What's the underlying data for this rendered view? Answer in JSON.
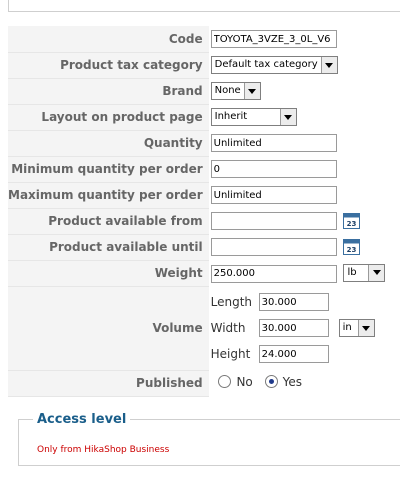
{
  "fields": {
    "code": {
      "label": "Code",
      "value": "TOYOTA_3VZE_3_0L_V6"
    },
    "tax_category": {
      "label": "Product tax category",
      "selected": "Default tax category"
    },
    "brand": {
      "label": "Brand",
      "selected": "None"
    },
    "layout": {
      "label": "Layout on product page",
      "selected": "Inherit"
    },
    "quantity": {
      "label": "Quantity",
      "value": "Unlimited"
    },
    "min_qty": {
      "label": "Minimum quantity per order",
      "value": "0"
    },
    "max_qty": {
      "label": "Maximum quantity per order",
      "value": "Unlimited"
    },
    "available_from": {
      "label": "Product available from",
      "value": "",
      "calendar_icon": "calendar-icon",
      "calendar_text": "23"
    },
    "available_until": {
      "label": "Product available until",
      "value": "",
      "calendar_icon": "calendar-icon",
      "calendar_text": "23"
    },
    "weight": {
      "label": "Weight",
      "value": "250.000",
      "unit": "lb"
    },
    "volume": {
      "label": "Volume",
      "length_label": "Length",
      "length": "30.000",
      "width_label": "Width",
      "width": "30.000",
      "height_label": "Height",
      "height": "24.000",
      "unit": "in"
    },
    "published": {
      "label": "Published",
      "no_label": "No",
      "yes_label": "Yes",
      "selected": "Yes"
    }
  },
  "access": {
    "legend": "Access level",
    "note": "Only from HikaShop Business"
  },
  "colors": {
    "label": "#666666",
    "legend": "#1a5e8a",
    "note": "#cc0000"
  }
}
